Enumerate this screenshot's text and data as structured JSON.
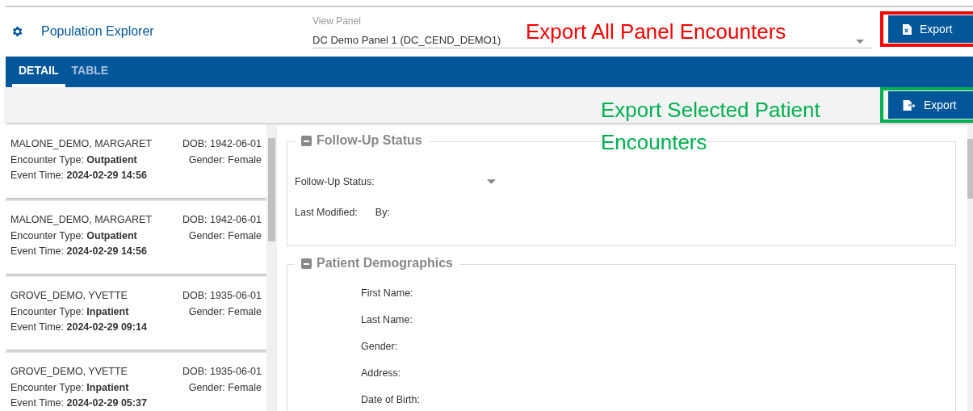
{
  "header": {
    "title": "Population Explorer",
    "view_panel": {
      "label": "View Panel",
      "value": "DC Demo Panel 1 (DC_CEND_DEMO1)"
    },
    "export_button": "Export"
  },
  "tabs": [
    {
      "label": "DETAIL",
      "selected": true
    },
    {
      "label": "TABLE",
      "selected": false
    }
  ],
  "toolbar": {
    "export_button": "Export"
  },
  "annotations": [
    {
      "text": "Export All Panel Encounters",
      "color": "#ff0000"
    },
    {
      "text": "Export Selected Patient Encounters",
      "color": "#00b050"
    }
  ],
  "patients": [
    {
      "name": "MALONE_DEMO, MARGARET",
      "dob": "DOB: 1942-06-01",
      "encounter": "Encounter Type: **Outpatient**",
      "gender": "Gender: Female",
      "event": "Event Time: **2024-02-29 14:56**"
    },
    {
      "name": "MALONE_DEMO, MARGARET",
      "dob": "DOB: 1942-06-01",
      "encounter": "Encounter Type: **Outpatient**",
      "gender": "Gender: Female",
      "event": "Event Time: **2024-02-29 14:56**"
    },
    {
      "name": "GROVE_DEMO, YVETTE",
      "dob": "DOB: 1935-06-01",
      "encounter": "Encounter Type: **Inpatient**",
      "gender": "Gender: Female",
      "event": "Event Time: **2024-02-29 09:14**"
    },
    {
      "name": "GROVE_DEMO, YVETTE",
      "dob": "DOB: 1935-06-01",
      "encounter": "Encounter Type: **Inpatient**",
      "gender": "Gender: Female",
      "event": "Event Time: **2024-02-29 05:37**"
    }
  ],
  "follow_up": {
    "title": "Follow-Up Status",
    "status_label": "Follow-Up Status:",
    "last_modified": "Last Modified:",
    "by": "By:"
  },
  "demographics": {
    "title": "Patient Demographics",
    "fields": [
      "First Name:",
      "Last Name:",
      "Gender:",
      "Address:",
      "Date of Birth:"
    ]
  }
}
